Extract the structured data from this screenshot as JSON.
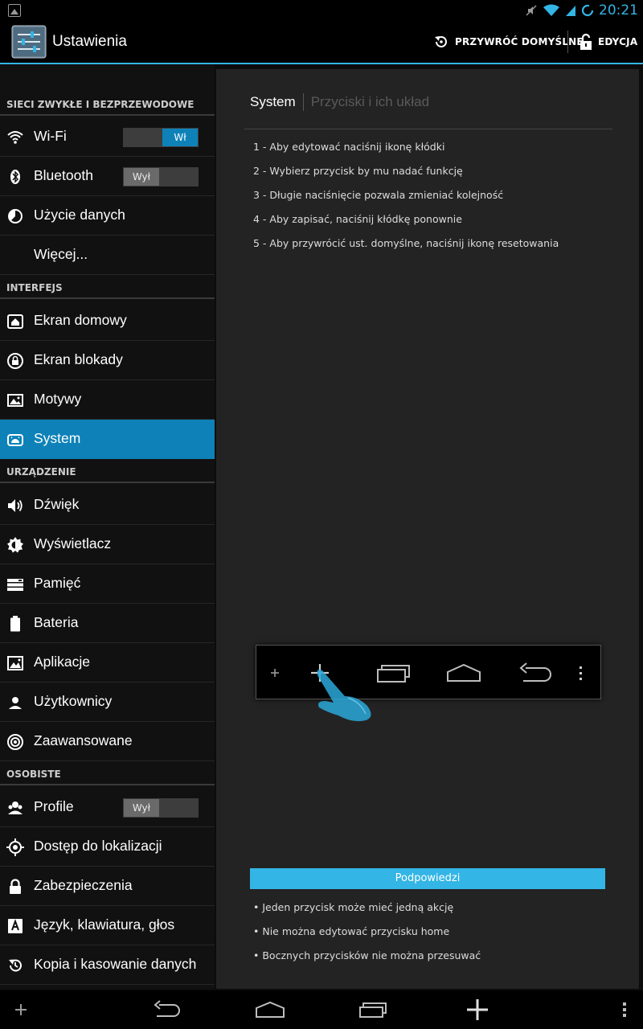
{
  "status_bar": {
    "time": "20:21"
  },
  "action_bar": {
    "title": "Ustawienia",
    "reset_label": "PRZYWRÓĆ DOMYŚLNE",
    "edit_label": "EDYCJA"
  },
  "sections": {
    "wireless": "SIECI ZWYKŁE I BEZPRZEWODOWE",
    "interface": "INTERFEJS",
    "device": "URZĄDZENIE",
    "personal": "OSOBISTE"
  },
  "items": {
    "wifi": "Wi-Fi",
    "bluetooth": "Bluetooth",
    "data_usage": "Użycie danych",
    "more": "Więcej...",
    "home_screen": "Ekran domowy",
    "lock_screen": "Ekran blokady",
    "themes": "Motywy",
    "system": "System",
    "sound": "Dźwięk",
    "display": "Wyświetlacz",
    "storage": "Pamięć",
    "battery": "Bateria",
    "apps": "Aplikacje",
    "users": "Użytkownicy",
    "advanced": "Zaawansowane",
    "profiles": "Profile",
    "location": "Dostęp do lokalizacji",
    "security": "Zabezpieczenia",
    "language": "Język, klawiatura, głos",
    "backup": "Kopia i kasowanie danych"
  },
  "toggles": {
    "wifi": "Wł",
    "bluetooth": "Wył",
    "profiles": "Wył"
  },
  "tabs": {
    "active": "System",
    "inactive": "Przyciski i ich układ"
  },
  "steps": [
    "1 - Aby edytować naciśnij ikonę kłódki",
    "2 - Wybierz przycisk by mu nadać funkcję",
    "3 - Długie naciśnięcie pozwala zmieniać kolejność",
    "4 - Aby zapisać, naciśnij kłódkę ponownie",
    "5 - Aby przywrócić ust. domyślne, naciśnij ikonę resetowania"
  ],
  "hints": {
    "title": "Podpowiedzi",
    "items": [
      "• Jeden przycisk może mieć jedną akcję",
      "• Nie można edytować przycisku home",
      "• Bocznych przycisków nie można przesuwać"
    ]
  },
  "colors": {
    "accent": "#33b5e5",
    "selected": "#0e82b8"
  }
}
